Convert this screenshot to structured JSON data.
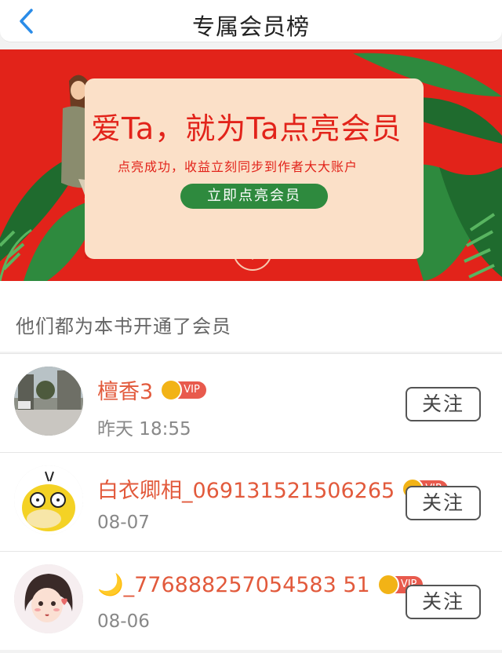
{
  "header": {
    "title": "专属会员榜",
    "back_icon": "chevron-left-icon",
    "accent_color": "#2a8ce8"
  },
  "banner": {
    "headline": "爱Ta，就为Ta点亮会员",
    "subtitle": "点亮成功，收益立刻同步到作者大大账户",
    "cta_label": "立即点亮会员",
    "background_color": "#e2231a",
    "card_color": "#fbe0c8",
    "cta_color": "#2e8a3e"
  },
  "section": {
    "heading": "他们都为本书开通了会员"
  },
  "members": [
    {
      "name": "檀香3",
      "vip_label": "VIP",
      "time": "昨天 18:55",
      "follow_label": "关注",
      "avatar": "street-photo"
    },
    {
      "name": "白衣卿相_069131521506265",
      "vip_label": "VIP",
      "time": "08-07",
      "follow_label": "关注",
      "avatar": "yellow-duck-cartoon"
    },
    {
      "name": "🌙_776888257054583 51",
      "vip_label": "VIP",
      "time": "08-06",
      "follow_label": "关注",
      "avatar": "anime-girl-drawing"
    }
  ],
  "colors": {
    "name_color": "#e25a3c",
    "vip_badge": "#e85a4d",
    "crown": "#f2b316"
  }
}
